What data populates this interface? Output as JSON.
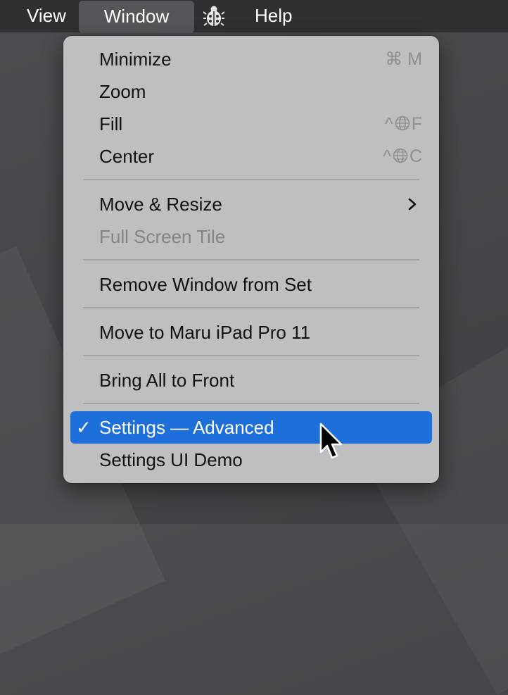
{
  "menubar": {
    "items": [
      {
        "label": "View"
      },
      {
        "label": "Window"
      },
      {
        "label": "Help"
      }
    ],
    "extra_icon": "ladybug-icon"
  },
  "menu": {
    "items": [
      {
        "label": "Minimize",
        "shortcut": "⌘ M"
      },
      {
        "label": "Zoom"
      },
      {
        "label": "Fill",
        "shortcut_prefix": "^",
        "shortcut_key": "F"
      },
      {
        "label": "Center",
        "shortcut_prefix": "^",
        "shortcut_key": "C"
      },
      {
        "label": "Move & Resize",
        "submenu": true
      },
      {
        "label": "Full Screen Tile",
        "disabled": true
      },
      {
        "label": "Remove Window from Set"
      },
      {
        "label": "Move to Maru iPad Pro 11"
      },
      {
        "label": "Bring All to Front"
      },
      {
        "label": "Settings — Advanced",
        "checked": true,
        "highlighted": true,
        "check_mark": "✓"
      },
      {
        "label": "Settings UI Demo"
      }
    ]
  },
  "colors": {
    "highlight": "#1f6fdb",
    "menu_bg": "#bdbfc1",
    "menubar_bg": "#2f3032"
  }
}
